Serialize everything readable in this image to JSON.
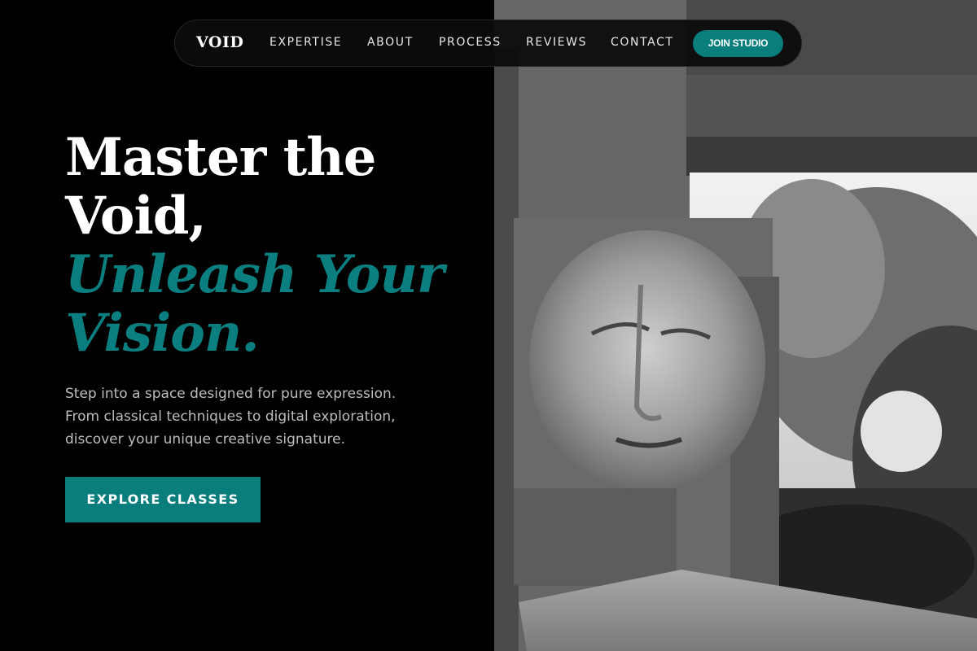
{
  "nav": {
    "logo": "VOID",
    "links": [
      "EXPERTISE",
      "ABOUT",
      "PROCESS",
      "REVIEWS",
      "CONTACT"
    ],
    "join_label": "JOIN STUDIO"
  },
  "hero": {
    "title_line1": "Master the",
    "title_line2": "Void,",
    "accent_line1": "Unleash Your",
    "accent_line2": "Vision.",
    "lead_lines": [
      "Step into a space designed for pure expression.",
      "From classical techniques to digital exploration,",
      "discover your unique creative signature."
    ],
    "cta_label": "EXPLORE CLASSES"
  },
  "colors": {
    "accent": "#0a7d7d",
    "background": "#000000",
    "text_muted": "#bdbdbd"
  }
}
